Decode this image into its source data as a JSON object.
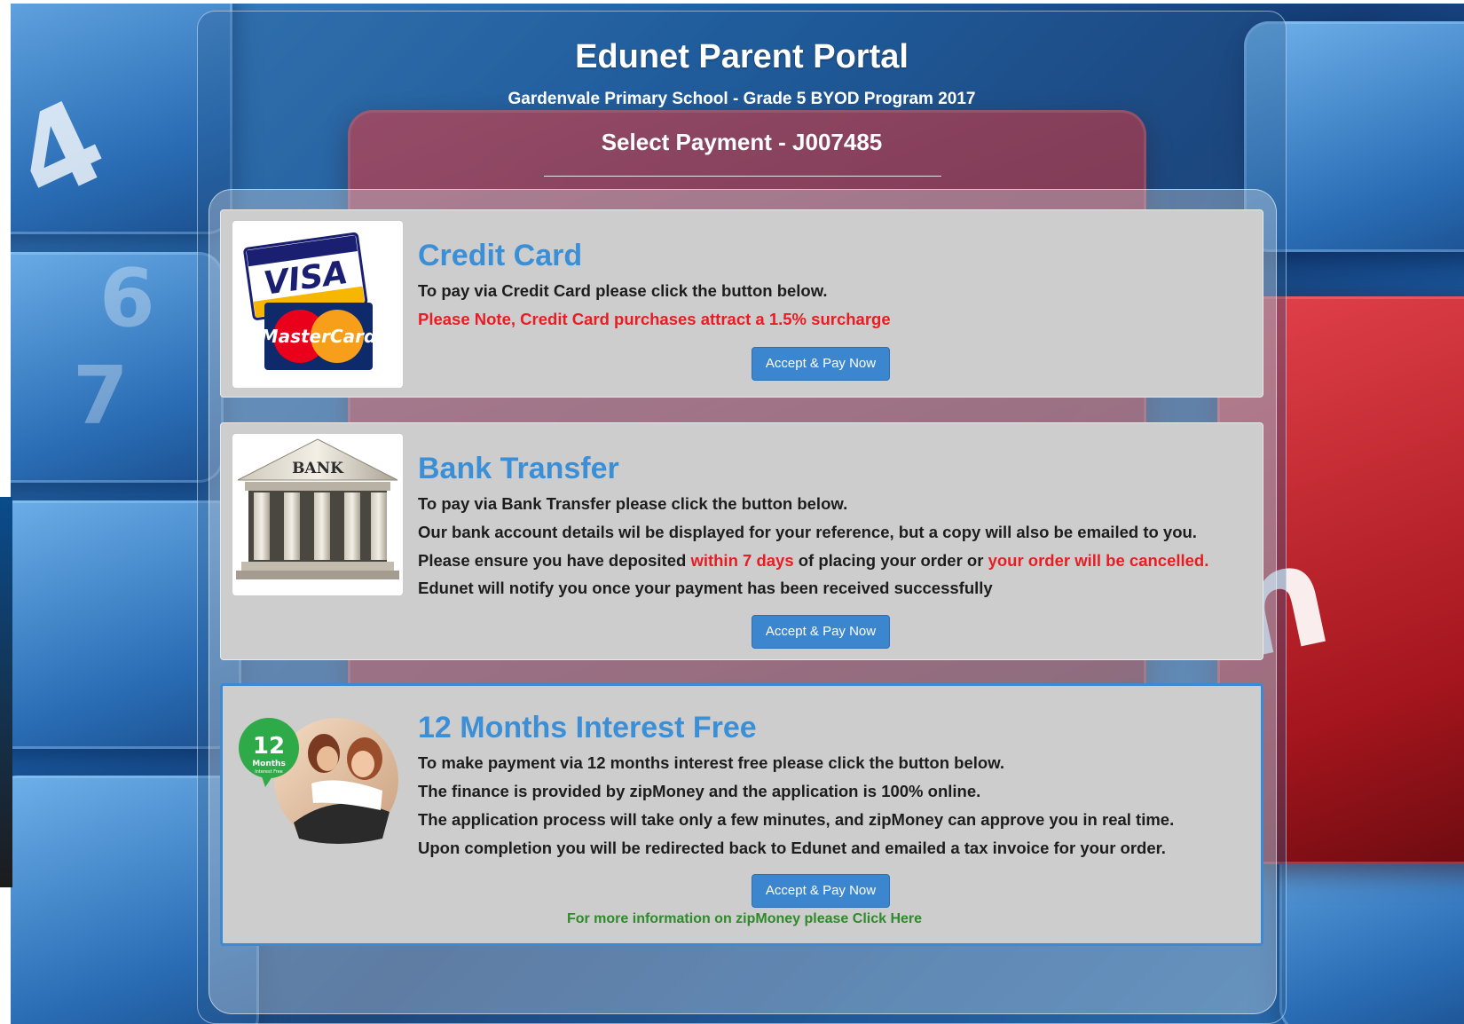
{
  "header": {
    "title": "Edunet Parent Portal",
    "subtitle": "Gardenvale Primary School - Grade 5 BYOD Program 2017",
    "page_heading": "Select Payment - J007485"
  },
  "background": {
    "glyphs": [
      "h",
      "6",
      "7",
      "4"
    ],
    "colors": {
      "key_blue": "#2a6db5",
      "key_red": "#a4151d"
    }
  },
  "payment_options": {
    "credit_card": {
      "image_icon": "visa-mastercard-logo",
      "visa_text": "VISA",
      "mastercard_text": "MasterCard",
      "title": "Credit Card",
      "line1": "To pay via Credit Card please click the button below.",
      "note": "Please Note, Credit Card purchases attract a 1.5% surcharge",
      "button": "Accept & Pay Now"
    },
    "bank_transfer": {
      "image_icon": "bank-building-icon",
      "bank_text": "BANK",
      "title": "Bank Transfer",
      "line1": "To pay via Bank Transfer please click the button below.",
      "line2": "Our bank account details wil be displayed for your reference, but a copy will also be emailed to you.",
      "line3_a": "Please ensure you have deposited ",
      "line3_b": "within 7 days",
      "line3_c": " of placing your order or ",
      "line3_d": "your order will be cancelled.",
      "line4": "Edunet will notify you once your payment has been received successfully",
      "button": "Accept & Pay Now"
    },
    "interest_free": {
      "image_icon": "zipmoney-12-months-image",
      "badge_number": "12",
      "badge_label": "Months",
      "badge_small": "Interest Free",
      "title": "12 Months Interest Free",
      "line1": "To make payment via 12 months interest free please click the button below.",
      "line2": "The finance is provided by zipMoney and the application is 100% online.",
      "line3": "The application process will take only a few minutes, and zipMoney can approve you in real time.",
      "line4": "Upon completion you will be redirected back to Edunet and emailed a tax invoice for your order.",
      "button": "Accept & Pay Now",
      "more_info": "For more information on zipMoney please Click Here"
    }
  },
  "colors": {
    "title_blue": "#3b8fd6",
    "warning_red": "#e81d24",
    "button_blue": "#3c86d0",
    "link_green": "#2e8a2a",
    "card_gray": "#cdcdcd"
  }
}
